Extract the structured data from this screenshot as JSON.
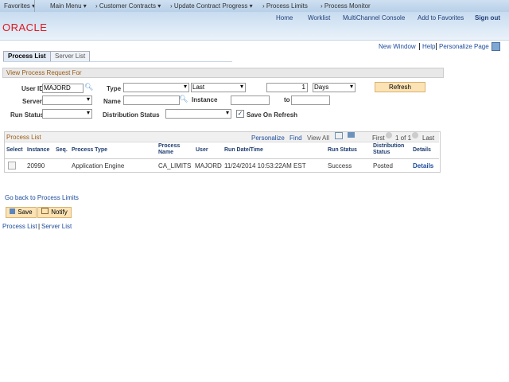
{
  "nav": {
    "favorites": "Favorites ▾",
    "main_menu": "Main Menu ▾",
    "crumbs": [
      "› Customer Contracts ▾",
      "› Update Contract Progress ▾",
      "› Process Limits",
      "› Process Monitor"
    ]
  },
  "header": {
    "links": [
      "Home",
      "Worklist",
      "MultiChannel Console",
      "Add to Favorites",
      "Sign out"
    ],
    "logo": "ORACLE"
  },
  "pagebar": {
    "new_window": "New Window",
    "help": "Help",
    "personalize": "Personalize Page"
  },
  "tabs": [
    "Process List",
    "Server List"
  ],
  "filter": {
    "title": "View Process Request For",
    "user_id_label": "User ID",
    "user_id": "MAJORD",
    "type_label": "Type",
    "type": "",
    "period": "Last",
    "count": "1",
    "unit": "Days",
    "refresh": "Refresh",
    "server_label": "Server",
    "name_label": "Name",
    "instance_label": "Instance",
    "to_label": "to",
    "run_status_label": "Run Status",
    "dist_status_label": "Distribution Status",
    "save_on_refresh": "Save On Refresh",
    "save_on_refresh_checked": true
  },
  "grid": {
    "title": "Process List",
    "personalize": "Personalize",
    "find": "Find",
    "view_all": "View All",
    "first": "First",
    "pager": "1 of 1",
    "last": "Last",
    "columns": [
      "Select",
      "Instance",
      "Seq.",
      "Process Type",
      "Process Name",
      "User",
      "Run Date/Time",
      "Run Status",
      "Distribution Status",
      "Details"
    ],
    "rows": [
      {
        "instance": "20990",
        "seq": "",
        "process_type": "Application Engine",
        "process_name": "CA_LIMITS",
        "user": "MAJORD",
        "run_datetime": "11/24/2014 10:53:22AM EST",
        "run_status": "Success",
        "dist_status": "Posted",
        "details": "Details"
      }
    ]
  },
  "footer": {
    "go_back": "Go back to Process Limits",
    "save": "Save",
    "notify": "Notify",
    "process_list": "Process List",
    "server_list": "Server List"
  }
}
